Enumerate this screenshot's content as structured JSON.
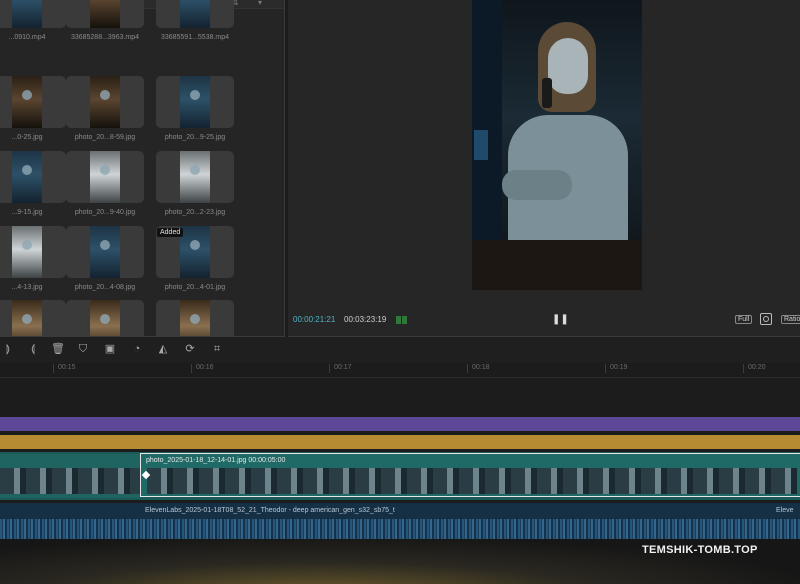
{
  "library": {
    "items": [
      {
        "label": "...0910.mp4",
        "tone": "blue"
      },
      {
        "label": "33685288...3963.mp4",
        "tone": "dark"
      },
      {
        "label": "33685591...5538.mp4",
        "tone": "blue"
      },
      {
        "label": "...0-25.jpg",
        "tone": "dark"
      },
      {
        "label": "photo_20...8-59.jpg",
        "tone": "dark"
      },
      {
        "label": "photo_20...9-25.jpg",
        "tone": "blue"
      },
      {
        "label": "...9-15.jpg",
        "tone": "blue"
      },
      {
        "label": "photo_20...9-40.jpg",
        "tone": "light"
      },
      {
        "label": "photo_20...2-23.jpg",
        "tone": "light"
      },
      {
        "label": "...4-13.jpg",
        "tone": "light"
      },
      {
        "label": "photo_20...4-08.jpg",
        "tone": "blue"
      },
      {
        "label": "photo_20...4-01.jpg",
        "tone": "blue"
      },
      {
        "label": "",
        "tone": "warm"
      },
      {
        "label": "",
        "tone": "warm"
      },
      {
        "label": "",
        "tone": "warm"
      }
    ],
    "added_badge": "Added"
  },
  "viewer": {
    "current_time": "00:00:21:21",
    "duration": "00:03:23:19",
    "pause_icon": "❚❚",
    "full_label": "Full",
    "ratio_label": "Ratio"
  },
  "toolbar": {
    "icons": [
      "split-icon",
      "split-alt-icon",
      "delete-icon",
      "shield-icon",
      "freeze-icon",
      "speed-icon",
      "mirror-icon",
      "rotate-icon",
      "crop-icon"
    ]
  },
  "ruler": {
    "ticks": [
      "00:15",
      "00:16",
      "00:17",
      "00:18",
      "00:19",
      "00:20"
    ]
  },
  "timeline": {
    "clip_name": "photo_2025-01-18_12-14-01.jpg",
    "clip_duration": "00:00:05:00",
    "audio_name": "ElevenLabs_2025-01-18T08_52_21_Theodor - deep american_gen_s32_sb75_t",
    "audio_name_end": "Eleve"
  },
  "watermark": "TEMSHIK-TOMB.TOP"
}
